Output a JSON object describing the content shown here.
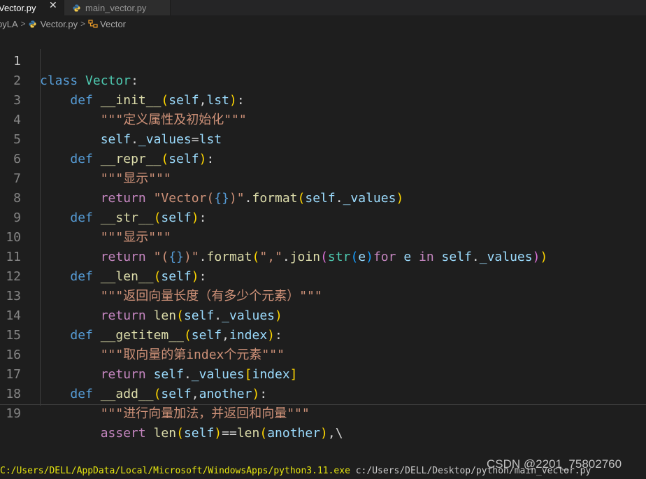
{
  "tabs": [
    {
      "label": "Vector.py",
      "active": true,
      "close_glyph": "✕"
    },
    {
      "label": "main_vector.py",
      "active": false,
      "icon": "python-icon"
    }
  ],
  "breadcrumb": {
    "items": [
      "pyLA",
      "Vector.py",
      "Vector"
    ],
    "separator": ">"
  },
  "editor": {
    "current_line": 1,
    "line_numbers": [
      "1",
      "2",
      "3",
      "4",
      "5",
      "6",
      "7",
      "8",
      "9",
      "10",
      "11",
      "12",
      "13",
      "14",
      "15",
      "16",
      "17",
      "18",
      "19"
    ],
    "lines": [
      "class Vector:",
      "    def __init__(self,lst):",
      "        \"\"\"定义属性及初始化\"\"\"",
      "        self._values=lst",
      "    def __repr__(self):",
      "        \"\"\"显示\"\"\"",
      "        return \"Vector({})\".format(self._values)",
      "    def __str__(self):",
      "        \"\"\"显示\"\"\"",
      "        return \"({})\".format(\",\".join(str(e)for e in self._values))",
      "    def __len__(self):",
      "        \"\"\"返回向量长度（有多少个元素）\"\"\"",
      "        return len(self._values)",
      "    def __getitem__(self,index):",
      "        \"\"\"取向量的第index个元素\"\"\"",
      "        return self._values[index]",
      "    def __add__(self,another):",
      "        \"\"\"进行向量加法，并返回和向量\"\"\"",
      "        assert len(self)==len(another),\\"
    ],
    "tokens": {
      "docstring_init": "\"\"\"定义属性及初始化\"\"\"",
      "docstring_show": "\"\"\"显示\"\"\"",
      "docstring_len": "\"\"\"返回向量长度（有多少个元素）\"\"\"",
      "docstring_getitem": "\"\"\"取向量的第index个元素\"\"\"",
      "docstring_add": "\"\"\"进行向量加法，并返回和向量\"\"\""
    }
  },
  "terminal": {
    "executable": "C:/Users/DELL/AppData/Local/Microsoft/WindowsApps/python3.11.exe",
    "script_path": "c:/Users/DELL/Desktop/python/main_vector.py"
  },
  "watermark": "CSDN @2201_75802760",
  "colors": {
    "background": "#1e1e1e",
    "keyword": "#569cd6",
    "control": "#c586c0",
    "function": "#dcdcaa",
    "class": "#4ec9b0",
    "string": "#ce9178",
    "bracket1": "#ffd700",
    "bracket2": "#da70d6",
    "bracket3": "#179fff"
  }
}
